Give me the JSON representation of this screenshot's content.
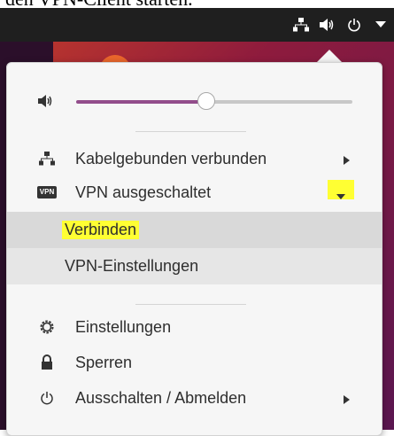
{
  "caption": "den VPN-Client starten.",
  "menu": {
    "network_label": "Kabelgebunden verbunden",
    "vpn_label": "VPN ausgeschaltet",
    "vpn_icon_text": "VPN",
    "connect_label": "Verbinden",
    "vpn_settings_label": "VPN-Einstellungen",
    "settings_label": "Einstellungen",
    "lock_label": "Sperren",
    "power_label": "Ausschalten / Abmelden",
    "volume_level": 0.47
  },
  "colors": {
    "highlight": "#ffff33",
    "slider_fill": "#924d8b",
    "topbar": "#1f1f1f"
  }
}
